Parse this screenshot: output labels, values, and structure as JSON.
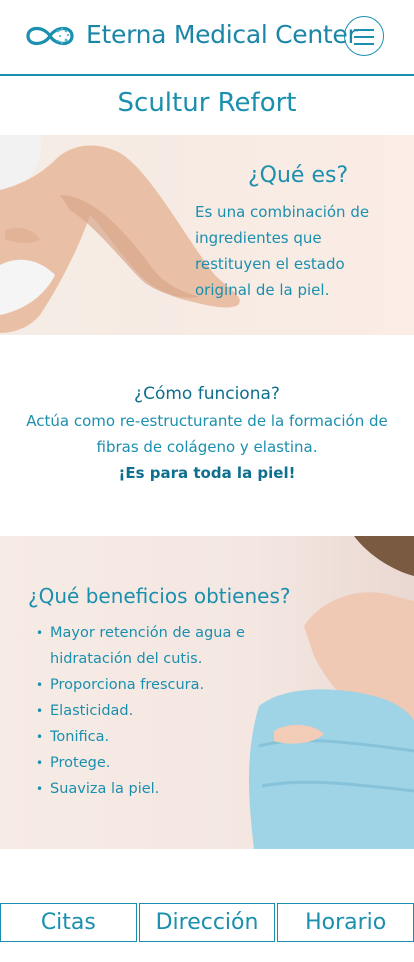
{
  "header": {
    "brand": "Eterna Medical Center",
    "logo_icon": "infinity-logo-icon",
    "menu_icon": "hamburger-menu-icon"
  },
  "page_title": "Scultur Refort",
  "section_que_es": {
    "title": "¿Qué es?",
    "text": "Es una combinación de ingredientes que  restituyen el estado original de la piel."
  },
  "section_como": {
    "title": "¿Cómo funciona?",
    "text": "Actúa como re-estructurante de la formación de fibras de colágeno y elastina.",
    "highlight": "¡Es para toda la piel!"
  },
  "section_beneficios": {
    "title": "¿Qué beneficios obtienes?",
    "items": [
      "Mayor retención de agua e hidratación del cutis.",
      "Proporciona frescura.",
      "Elasticidad.",
      "Tonifica.",
      "Protege.",
      "Suaviza la piel."
    ]
  },
  "bottom_nav": {
    "citas": "Citas",
    "direccion": "Dirección",
    "horario": "Horario"
  },
  "colors": {
    "accent": "#1b8fae",
    "accent_dark": "#0e6f8e"
  }
}
